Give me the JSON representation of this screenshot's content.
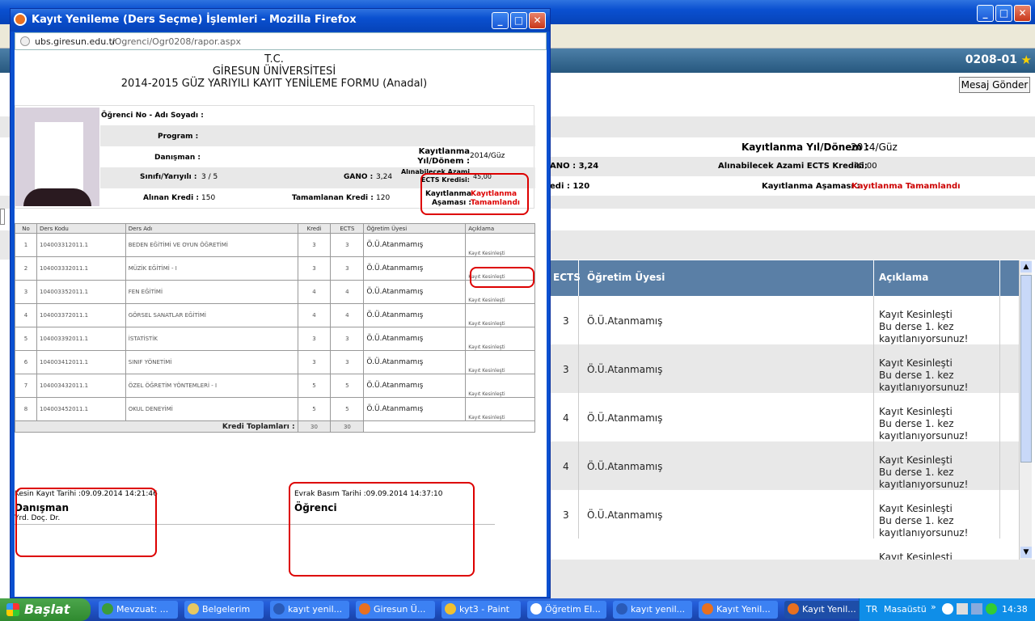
{
  "popup": {
    "title": "Kayıt Yenileme (Ders Seçme) İşlemleri - Mozilla Firefox",
    "url_host": "ubs.giresun.edu.tr",
    "url_path": "/Ogrenci/Ogr0208/rapor.aspx",
    "header": {
      "line1": "T.C.",
      "line2": "GİRESUN ÜNİVERSİTESİ",
      "line3": "2014-2015 GÜZ YARIYILI KAYIT YENİLEME FORMU (Anadal)"
    },
    "info": {
      "ogrenci_label": "Öğrenci No - Adı Soyadı :",
      "program_label": "Program :",
      "danisman_label": "Danışman :",
      "kayit_donem_label": "Kayıtlanma Yıl/Dönem :",
      "kayit_donem_value": "2014/Güz",
      "sinif_label": "Sınıfı/Yarıyılı :",
      "sinif_value": "3 / 5",
      "gano_label": "GANO :",
      "gano_value": "3,24",
      "azami_label": "Alınabilecek Azami ECTS Kredisi:",
      "azami_value": "45,00",
      "alinan_label": "Alınan Kredi :",
      "alinan_value": "150",
      "tamamlanan_label": "Tamamlanan Kredi :",
      "tamamlanan_value": "120",
      "asama_label": "Kayıtlanma Aşaması :",
      "asama_value": "Kayıtlanma Tamamlandı"
    },
    "table": {
      "headers": [
        "No",
        "Ders Kodu",
        "Ders Adı",
        "Kredi",
        "ECTS",
        "Öğretim Üyesi",
        "Açıklama"
      ],
      "rows": [
        [
          "1",
          "104003312011.1",
          "BEDEN EĞİTİMİ VE OYUN ÖĞRETİMİ",
          "3",
          "3",
          "Ö.Ü.Atanmamış",
          "Kayıt Kesinleşti"
        ],
        [
          "2",
          "104003332011.1",
          "MÜZİK EĞİTİMİ - I",
          "3",
          "3",
          "Ö.Ü.Atanmamış",
          "Kayıt Kesinleşti"
        ],
        [
          "3",
          "104003352011.1",
          "FEN EĞİTİMİ",
          "4",
          "4",
          "Ö.Ü.Atanmamış",
          "Kayıt Kesinleşti"
        ],
        [
          "4",
          "104003372011.1",
          "GÖRSEL SANATLAR EĞİTİMİ",
          "4",
          "4",
          "Ö.Ü.Atanmamış",
          "Kayıt Kesinleşti"
        ],
        [
          "5",
          "104003392011.1",
          "İSTATİSTİK",
          "3",
          "3",
          "Ö.Ü.Atanmamış",
          "Kayıt Kesinleşti"
        ],
        [
          "6",
          "104003412011.1",
          "SINIF YÖNETİMİ",
          "3",
          "3",
          "Ö.Ü.Atanmamış",
          "Kayıt Kesinleşti"
        ],
        [
          "7",
          "104003432011.1",
          "ÖZEL ÖĞRETİM YÖNTEMLERİ - I",
          "5",
          "5",
          "Ö.Ü.Atanmamış",
          "Kayıt Kesinleşti"
        ],
        [
          "8",
          "104003452011.1",
          "OKUL DENEYİMİ",
          "5",
          "5",
          "Ö.Ü.Atanmamış",
          "Kayıt Kesinleşti"
        ]
      ],
      "total_label": "Kredi Toplamları :",
      "total_kredi": "30",
      "total_ects": "30"
    },
    "footer": {
      "kesin_kayit": "Kesin Kayıt Tarihi :09.09.2014 14:21:46",
      "danisman": "Danışman",
      "unvan": "Yrd. Doç. Dr.",
      "evrak": "Evrak Basım Tarihi :09.09.2014 14:37:10",
      "ogrenci": "Öğrenci"
    }
  },
  "bg": {
    "code": "0208-01",
    "mesaj_button": "Mesaj Gönder",
    "kayit_donem_label": "Kayıtlanma Yıl/Dönem :",
    "kayit_donem_value": "2014/Güz",
    "gano": "ANO : 3,24",
    "azami_label": "Alınabilecek Azami ECTS Kredisi:",
    "azami_value": "45,00",
    "kredi": "edi : 120",
    "asama_label": "Kayıtlanma Aşaması :",
    "asama_value": "Kayıtlanma Tamamlandı",
    "headers": {
      "ects": "ECTS",
      "ogretim": "Öğretim Üyesi",
      "aciklama": "Açıklama"
    },
    "rows": [
      {
        "ects": "3",
        "ogretim": "Ö.Ü.Atanmamış",
        "aciklama": [
          "Kayıt Kesinleşti",
          "Bu derse 1. kez",
          "kayıtlanıyorsunuz!"
        ]
      },
      {
        "ects": "3",
        "ogretim": "Ö.Ü.Atanmamış",
        "aciklama": [
          "Kayıt Kesinleşti",
          "Bu derse 1. kez",
          "kayıtlanıyorsunuz!"
        ]
      },
      {
        "ects": "4",
        "ogretim": "Ö.Ü.Atanmamış",
        "aciklama": [
          "Kayıt Kesinleşti",
          "Bu derse 1. kez",
          "kayıtlanıyorsunuz!"
        ]
      },
      {
        "ects": "4",
        "ogretim": "Ö.Ü.Atanmamış",
        "aciklama": [
          "Kayıt Kesinleşti",
          "Bu derse 1. kez",
          "kayıtlanıyorsunuz!"
        ]
      },
      {
        "ects": "3",
        "ogretim": "Ö.Ü.Atanmamış",
        "aciklama": [
          "Kayıt Kesinleşti",
          "Bu derse 1. kez",
          "kayıtlanıyorsunuz!"
        ]
      }
    ],
    "partial_row": "Kayıt Kesinleşti"
  },
  "taskbar": {
    "start": "Başlat",
    "items": [
      {
        "label": "Mevzuat: ...",
        "icon_color": "#3b9c3b"
      },
      {
        "label": "Belgelerim",
        "icon_color": "#e8c860"
      },
      {
        "label": "kayıt yenil...",
        "icon_color": "#2a5bb8"
      },
      {
        "label": "Giresun Ü...",
        "icon_color": "#e87020"
      },
      {
        "label": "kyt3 - Paint",
        "icon_color": "#f0c030"
      },
      {
        "label": "Öğretim El...",
        "icon_color": "#ffffff"
      },
      {
        "label": "kayıt yenil...",
        "icon_color": "#2a5bb8"
      },
      {
        "label": "Kayıt Yenil...",
        "icon_color": "#e87020"
      },
      {
        "label": "Kayıt Yenil...",
        "icon_color": "#e87020"
      }
    ],
    "lang": "TR",
    "desktop": "Masaüstü",
    "time": "14:38"
  }
}
